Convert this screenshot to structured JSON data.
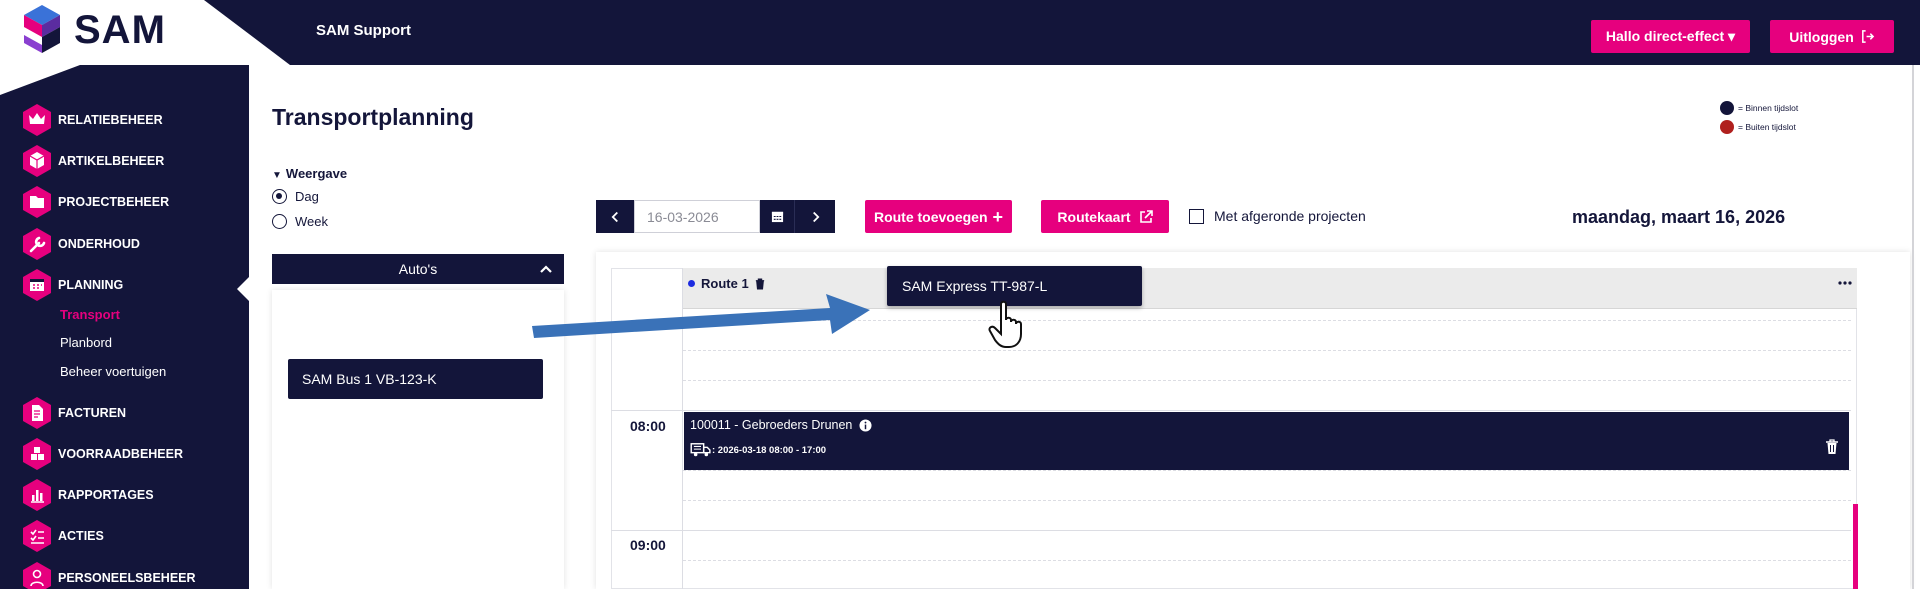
{
  "app": {
    "brand": "SAM",
    "top_title": "SAM Support",
    "user_button": "Hallo direct-effect ▾",
    "logout_button": "Uitloggen"
  },
  "sidebar": {
    "items": [
      {
        "label": "RELATIEBEHEER",
        "icon": "crown-icon"
      },
      {
        "label": "ARTIKELBEHEER",
        "icon": "box-icon"
      },
      {
        "label": "PROJECTBEHEER",
        "icon": "folder-icon"
      },
      {
        "label": "ONDERHOUD",
        "icon": "wrench-icon"
      },
      {
        "label": "PLANNING",
        "icon": "calendar-icon"
      },
      {
        "label": "FACTUREN",
        "icon": "invoice-icon"
      },
      {
        "label": "VOORRAADBEHEER",
        "icon": "boxes-icon"
      },
      {
        "label": "RAPPORTAGES",
        "icon": "chart-icon"
      },
      {
        "label": "ACTIES",
        "icon": "checklist-icon"
      },
      {
        "label": "PERSONEELSBEHEER",
        "icon": "person-icon"
      }
    ],
    "planning_sub": [
      "Transport",
      "Planbord",
      "Beheer voertuigen"
    ]
  },
  "main": {
    "title": "Transportplanning",
    "weergave": "Weergave",
    "view_options": [
      "Dag",
      "Week"
    ],
    "view_selected": "Dag",
    "autos_header": "Auto's",
    "vehicle": "SAM Bus 1 VB-123-K",
    "date_value": "16-03-2026",
    "add_route_button": "Route toevoegen",
    "route_map_button": "Routekaart",
    "checkbox_label": "Met afgeronde projecten",
    "date_long": "maandag, maart 16, 2026"
  },
  "legend": {
    "inside": {
      "label": "= Binnen tijdslot",
      "color": "#13153a"
    },
    "outside": {
      "label": "= Buiten tijdslot",
      "color": "#b0201e"
    }
  },
  "timeline": {
    "route_label": "Route 1",
    "drag_vehicle": "SAM Express TT-987-L",
    "times": [
      "08:00",
      "09:00"
    ],
    "project": {
      "title": "100011 - Gebroeders Drunen",
      "time": ": 2026-03-18 08:00 - 17:00"
    }
  },
  "colors": {
    "navy": "#13153a",
    "pink": "#e6007e",
    "arrow": "#3a72b8"
  }
}
